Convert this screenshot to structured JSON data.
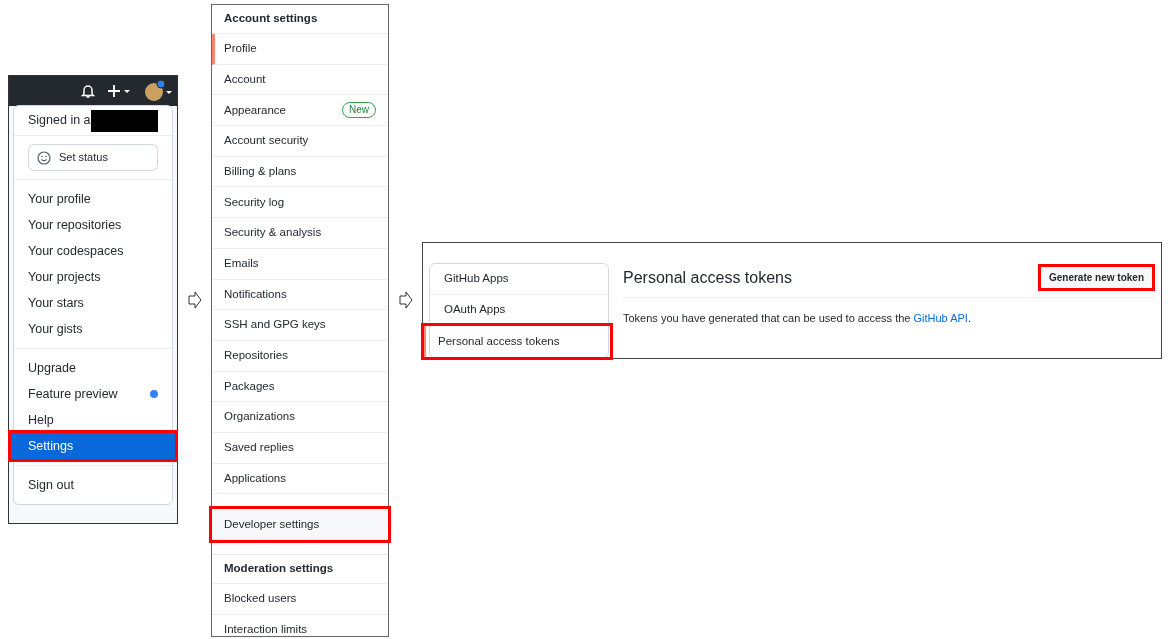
{
  "user_menu": {
    "avatar_has_notification": true,
    "signed_in_text": "Signed in a",
    "username_redacted": true,
    "status_button": "Set status",
    "groups": [
      [
        {
          "label": "Your profile",
          "selected": false,
          "highlighted": false,
          "dot": false
        },
        {
          "label": "Your repositories",
          "selected": false,
          "highlighted": false,
          "dot": false
        },
        {
          "label": "Your codespaces",
          "selected": false,
          "highlighted": false,
          "dot": false
        },
        {
          "label": "Your projects",
          "selected": false,
          "highlighted": false,
          "dot": false
        },
        {
          "label": "Your stars",
          "selected": false,
          "highlighted": false,
          "dot": false
        },
        {
          "label": "Your gists",
          "selected": false,
          "highlighted": false,
          "dot": false
        }
      ],
      [
        {
          "label": "Upgrade",
          "selected": false,
          "highlighted": false,
          "dot": false
        },
        {
          "label": "Feature preview",
          "selected": false,
          "highlighted": false,
          "dot": true
        },
        {
          "label": "Help",
          "selected": false,
          "highlighted": false,
          "dot": false
        },
        {
          "label": "Settings",
          "selected": true,
          "highlighted": true,
          "dot": false
        }
      ],
      [
        {
          "label": "Sign out",
          "selected": false,
          "highlighted": false,
          "dot": false
        }
      ]
    ]
  },
  "settings_sidebar": {
    "groups": [
      {
        "title": "Account settings",
        "items": [
          {
            "label": "Profile",
            "selected": true,
            "highlighted": false
          },
          {
            "label": "Account",
            "selected": false,
            "highlighted": false
          },
          {
            "label": "Appearance",
            "selected": false,
            "highlighted": false,
            "badge": "New"
          },
          {
            "label": "Account security",
            "selected": false,
            "highlighted": false
          },
          {
            "label": "Billing & plans",
            "selected": false,
            "highlighted": false
          },
          {
            "label": "Security log",
            "selected": false,
            "highlighted": false
          },
          {
            "label": "Security & analysis",
            "selected": false,
            "highlighted": false
          },
          {
            "label": "Emails",
            "selected": false,
            "highlighted": false
          },
          {
            "label": "Notifications",
            "selected": false,
            "highlighted": false
          },
          {
            "label": "SSH and GPG keys",
            "selected": false,
            "highlighted": false
          },
          {
            "label": "Repositories",
            "selected": false,
            "highlighted": false
          },
          {
            "label": "Packages",
            "selected": false,
            "highlighted": false
          },
          {
            "label": "Organizations",
            "selected": false,
            "highlighted": false
          },
          {
            "label": "Saved replies",
            "selected": false,
            "highlighted": false
          },
          {
            "label": "Applications",
            "selected": false,
            "highlighted": false
          }
        ]
      },
      {
        "items": [
          {
            "label": "Developer settings",
            "selected": false,
            "highlighted": true
          }
        ]
      },
      {
        "title": "Moderation settings",
        "items": [
          {
            "label": "Blocked users",
            "selected": false,
            "highlighted": false
          },
          {
            "label": "Interaction limits",
            "selected": false,
            "highlighted": false
          }
        ]
      }
    ]
  },
  "developer_settings": {
    "nav": [
      {
        "label": "GitHub Apps",
        "selected": false,
        "highlighted": false
      },
      {
        "label": "OAuth Apps",
        "selected": false,
        "highlighted": false
      },
      {
        "label": "Personal access tokens",
        "selected": true,
        "highlighted": true
      }
    ],
    "title": "Personal access tokens",
    "button": {
      "label": "Generate new token",
      "highlighted": true
    },
    "description": "Tokens you have generated that can be used to access the ",
    "link": "GitHub API",
    "description_end": "."
  }
}
